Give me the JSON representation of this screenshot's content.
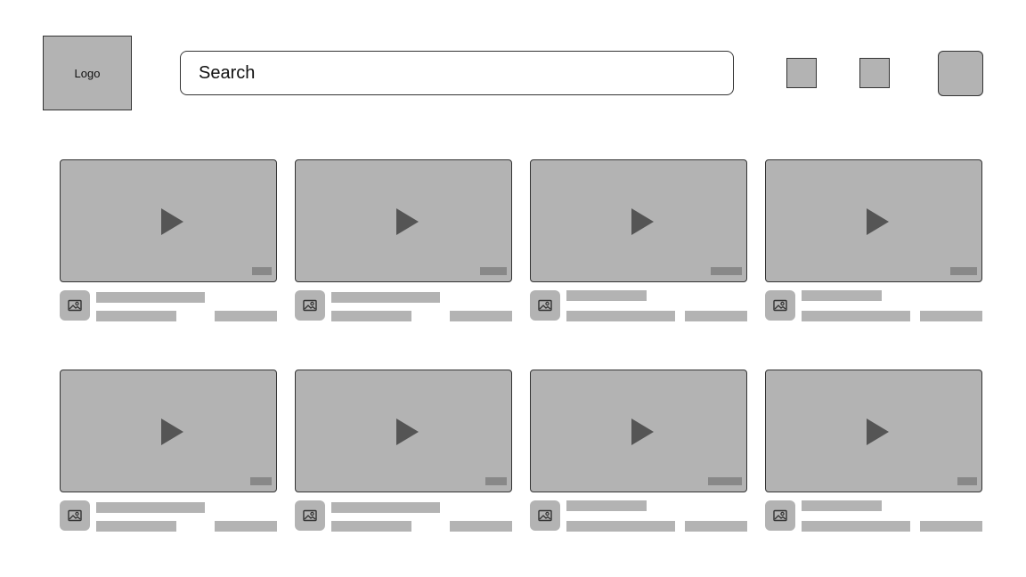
{
  "header": {
    "logo_label": "Logo",
    "search_placeholder": "Search",
    "buttons": [
      "header-button-1",
      "header-button-2",
      "profile-avatar"
    ]
  },
  "colors": {
    "placeholder_fill": "#b3b3b3",
    "outline": "#333333",
    "play_icon": "#555555",
    "duration_badge": "#888888",
    "background": "#ffffff"
  },
  "icons": {
    "play": "play-icon",
    "channel": "image-icon"
  },
  "video_grid": {
    "rows": 2,
    "columns": 4,
    "cards": [
      {
        "id": 1
      },
      {
        "id": 2
      },
      {
        "id": 3
      },
      {
        "id": 4
      },
      {
        "id": 5
      },
      {
        "id": 6
      },
      {
        "id": 7
      },
      {
        "id": 8
      }
    ]
  }
}
